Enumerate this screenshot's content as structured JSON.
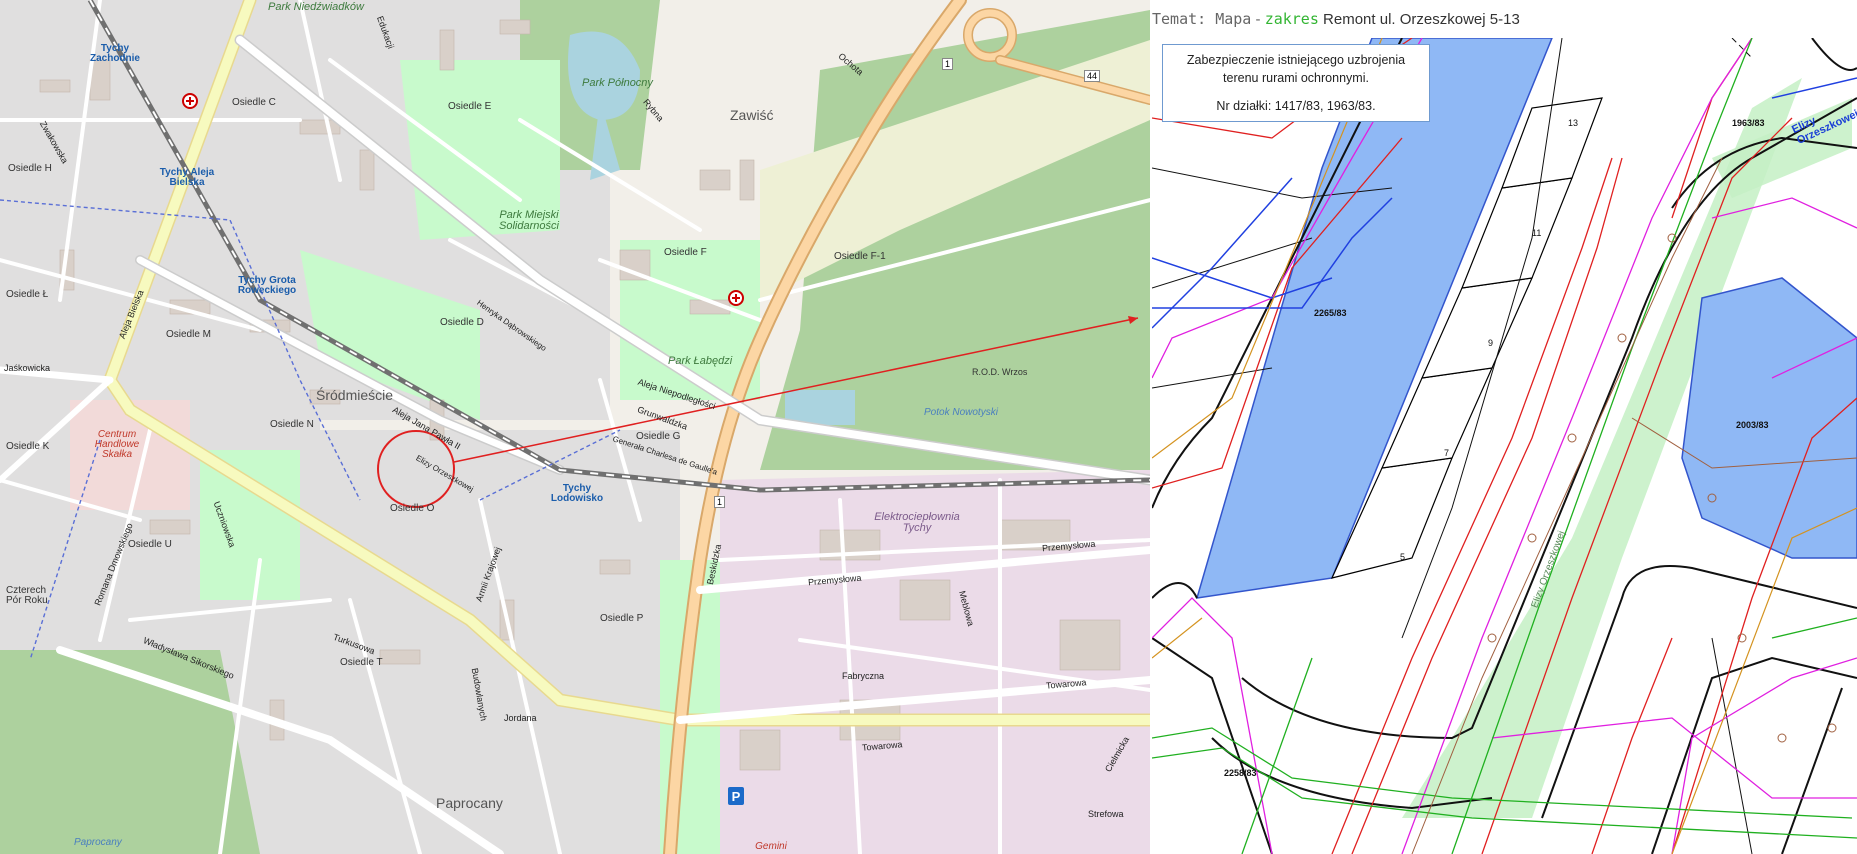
{
  "map": {
    "parks": {
      "polnocny": "Park Północny",
      "solidarnosci": "Park Miejski Solidarności",
      "labedzi": "Park Łabędzi",
      "niedzwiadkow": "Park Niedźwiadków"
    },
    "districts": {
      "srodmiescie": "Śródmieście",
      "zawisc": "Zawiść",
      "paprocany": "Paprocany",
      "paprocany_water": "Paprocany"
    },
    "estates": {
      "c": "Osiedle C",
      "e": "Osiedle E",
      "h": "Osiedle H",
      "l": "Osiedle Ł",
      "m": "Osiedle M",
      "d": "Osiedle D",
      "n": "Osiedle N",
      "k": "Osiedle K",
      "o": "Osiedle O",
      "g": "Osiedle G",
      "f": "Osiedle F",
      "u": "Osiedle U",
      "p": "Osiedle P",
      "t": "Osiedle T",
      "ff": "Osiedle F-1"
    },
    "stops": {
      "zachodnie": "Tychy Zachodnie",
      "bielska": "Tychy Aleja Bielska",
      "grota": "Tychy Grota Roweckiego",
      "lodowisko": "Tychy Lodowisko"
    },
    "pois": {
      "centrum": "Centrum Handlowe Skałka",
      "elektrocieplownia": "Elektrociepłownia Tychy",
      "rod": "R.O.D. Wrzos",
      "potok": "Potok Nowotyski",
      "czterech": "Czterech Pór Roku",
      "gemini": "Gemini"
    },
    "roads": {
      "beskidzka": "Beskidzka",
      "bielska": "Aleja Bielska",
      "niepodleglosci": "Aleja Niepodległości",
      "jana_pawla": "Aleja Jana Pawła II",
      "przemyslowa": "Przemysłowa",
      "towarowa": "Towarowa",
      "fabryczna": "Fabryczna",
      "edukacji": "Edukacji",
      "sikorskiego": "Władysława Sikorskiego",
      "armii": "Armii Krajowej",
      "orzeszkowej": "Elizy Orzeszkowej",
      "jaskowicka": "Jaśkowicka",
      "dmowskiego": "Romana Dmowskiego",
      "grota": "Grota Roweckiego",
      "rybna": "Rybna",
      "ochota": "Ochota",
      "meblowa": "Meblowa",
      "strefowa": "Strefowa",
      "cielmicka": "Cielmicka",
      "gen_charles": "Generała Charlesa de Gaulle'a",
      "zwakowska": "Zwakowska",
      "uczniowska": "Uczniowska",
      "turkusowa": "Turkusowa",
      "jordana": "Jordana",
      "grunwaldzka": "Grunwaldzka",
      "budowlanych": "Budowlanych",
      "henryka": "Henryka Dąbrowskiego"
    },
    "shields": {
      "s1a": "1",
      "s1b": "1",
      "s44": "44"
    }
  },
  "plan": {
    "header": {
      "topic": "Temat: Mapa",
      "sep": " - ",
      "scope": "zakres",
      "title": " Remont ul. Orzeszkowej 5-13"
    },
    "info": {
      "line1": "Zabezpieczenie istniejącego uzbrojenia terenu rurami ochronnymi.",
      "line2": "Nr działki: 1417/83, 1963/83."
    },
    "parcels": {
      "p2265": "2265/83",
      "p1963": "1963/83",
      "p2003": "2003/83",
      "p2258": "2258/83",
      "street": "Elizy Orzeszkowej",
      "street2": "Elizy Orzeszkowej"
    },
    "building_numbers": [
      "13",
      "11",
      "9",
      "7",
      "5"
    ]
  },
  "colors": {
    "building_fill": "#8fb8f5",
    "scope_fill": "#c4f0c4",
    "marker": "#e02020"
  }
}
